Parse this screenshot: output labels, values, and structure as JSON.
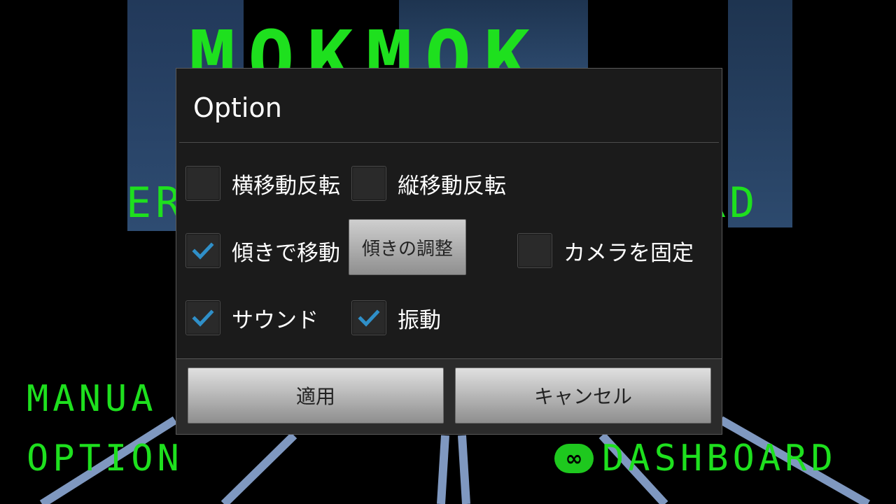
{
  "background": {
    "logo_text": "MOKMOK",
    "menu_left_fragment": "ER",
    "menu_right_fragment": "RD",
    "menu_manual": "MANUA",
    "menu_option": "OPTION",
    "menu_dashboard": "DASHBOARD",
    "dashboard_logo": "∞"
  },
  "dialog": {
    "title": "Option",
    "options": {
      "invert_horizontal": {
        "label": "横移動反転",
        "checked": false
      },
      "invert_vertical": {
        "label": "縦移動反転",
        "checked": false
      },
      "tilt_move": {
        "label": "傾きで移動",
        "checked": true
      },
      "fix_camera": {
        "label": "カメラを固定",
        "checked": false
      },
      "sound": {
        "label": "サウンド",
        "checked": true
      },
      "vibration": {
        "label": "振動",
        "checked": true
      }
    },
    "adjust_button_label": "傾きの調整",
    "apply_label": "適用",
    "cancel_label": "キャンセル"
  },
  "colors": {
    "neon_green": "#1ee01e",
    "check_blue": "#2f8fc8"
  }
}
